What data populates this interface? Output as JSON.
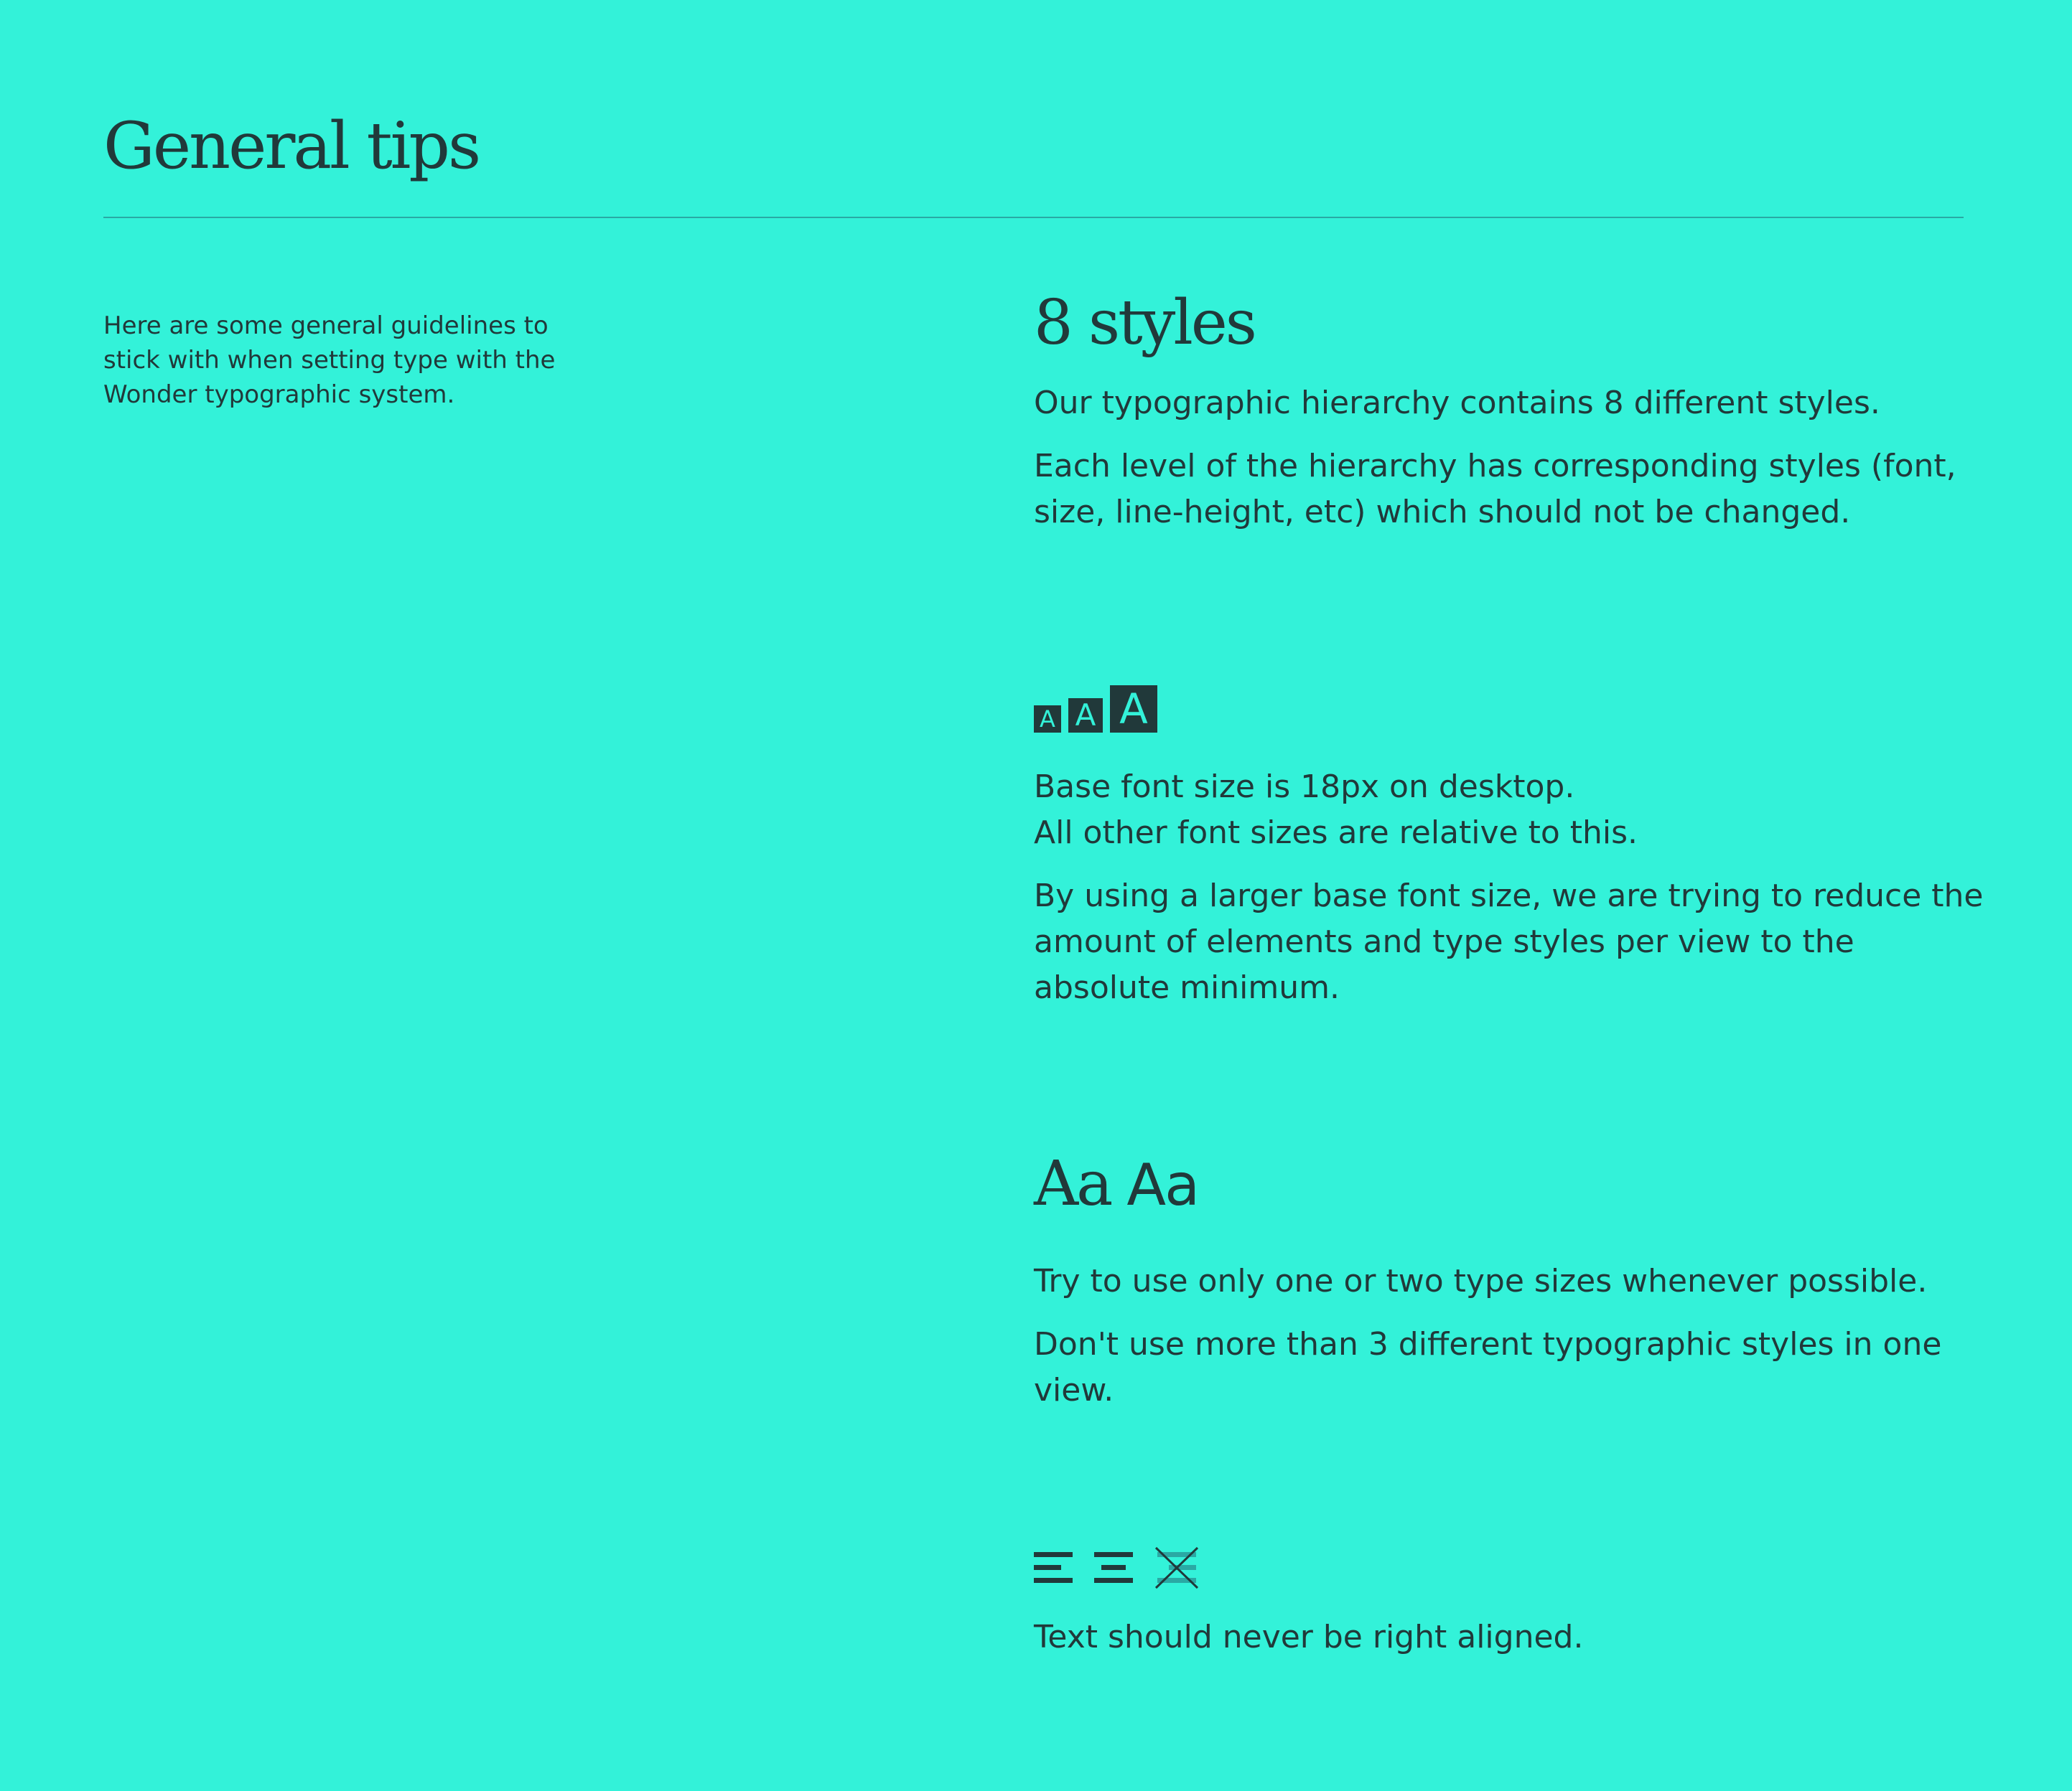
{
  "header": {
    "title": "General tips"
  },
  "intro": {
    "text": "Here are some general guidelines to stick with when setting type with the Wonder typographic system."
  },
  "sections": {
    "styles": {
      "title": "8 styles",
      "p1": "Our typographic hierarchy contains 8 different styles.",
      "p2": "Each level of the hierarchy has corresponding styles (font, size, line-height, etc) which should not be changed."
    },
    "base_size": {
      "icon_glyphs": [
        "A",
        "A",
        "A"
      ],
      "p1_line1": "Base font size is 18px on desktop.",
      "p1_line2": "All other font sizes are relative to this.",
      "p2": "By using a larger base font size, we are trying to reduce the amount of elements and type styles per view to the absolute minimum."
    },
    "type_sizes": {
      "sample_serif": "Aa",
      "sample_sans": "Aa",
      "p1": "Try to use only one or two type sizes whenever possible.",
      "p2": "Don't use more than 3 different typographic styles in one view."
    },
    "alignment": {
      "icons": [
        "align-left-icon",
        "align-center-icon",
        "align-right-crossed-icon"
      ],
      "p1": "Text should never be right aligned."
    }
  },
  "colors": {
    "background": "#33f2d9",
    "text": "#21393a",
    "divider": "#2aa9a4"
  }
}
